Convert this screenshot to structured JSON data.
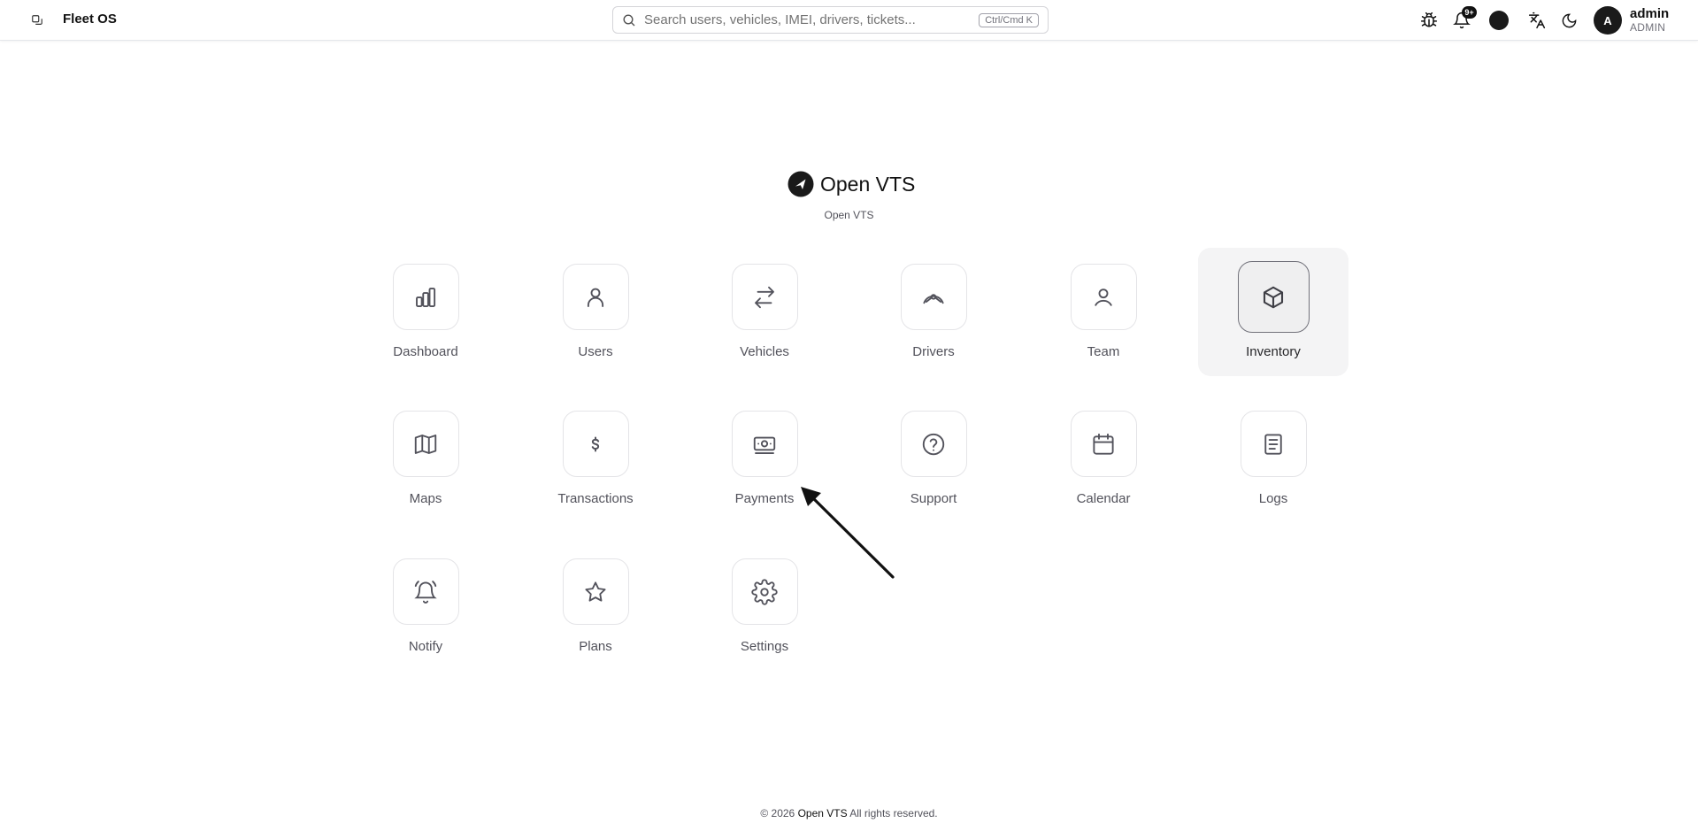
{
  "header": {
    "app_name": "Fleet OS",
    "search_placeholder": "Search users, vehicles, IMEI, drivers, tickets...",
    "search_shortcut": "Ctrl/Cmd K",
    "notification_badge": "9+",
    "icons": [
      "sidebar-toggle-icon",
      "bug-icon",
      "bell-icon",
      "status-dot",
      "translate-icon",
      "moon-icon"
    ],
    "user": {
      "initial": "A",
      "name": "admin",
      "role": "ADMIN"
    }
  },
  "brand": {
    "name": "Open VTS",
    "subtitle": "Open VTS"
  },
  "launcher": {
    "selected": "Inventory",
    "tiles": [
      {
        "label": "Dashboard",
        "icon": "bar-chart-icon"
      },
      {
        "label": "Users",
        "icon": "user-icon"
      },
      {
        "label": "Vehicles",
        "icon": "arrows-swap-icon"
      },
      {
        "label": "Drivers",
        "icon": "steering-wheel-icon"
      },
      {
        "label": "Team",
        "icon": "user-round-icon"
      },
      {
        "label": "Inventory",
        "icon": "box-icon"
      },
      {
        "label": "Maps",
        "icon": "map-icon"
      },
      {
        "label": "Transactions",
        "icon": "dollar-icon"
      },
      {
        "label": "Payments",
        "icon": "banknote-icon"
      },
      {
        "label": "Support",
        "icon": "help-circle-icon"
      },
      {
        "label": "Calendar",
        "icon": "calendar-icon"
      },
      {
        "label": "Logs",
        "icon": "document-icon"
      },
      {
        "label": "Notify",
        "icon": "bell-ring-icon"
      },
      {
        "label": "Plans",
        "icon": "star-icon"
      },
      {
        "label": "Settings",
        "icon": "gear-icon"
      }
    ]
  },
  "footer": {
    "prefix": "© 2026",
    "brand": "Open VTS",
    "suffix": "All rights reserved."
  },
  "colors": {
    "text_primary": "#111111",
    "text_muted": "#52525b",
    "border": "#e4e4e7",
    "active_tile_bg": "#f4f4f5"
  }
}
